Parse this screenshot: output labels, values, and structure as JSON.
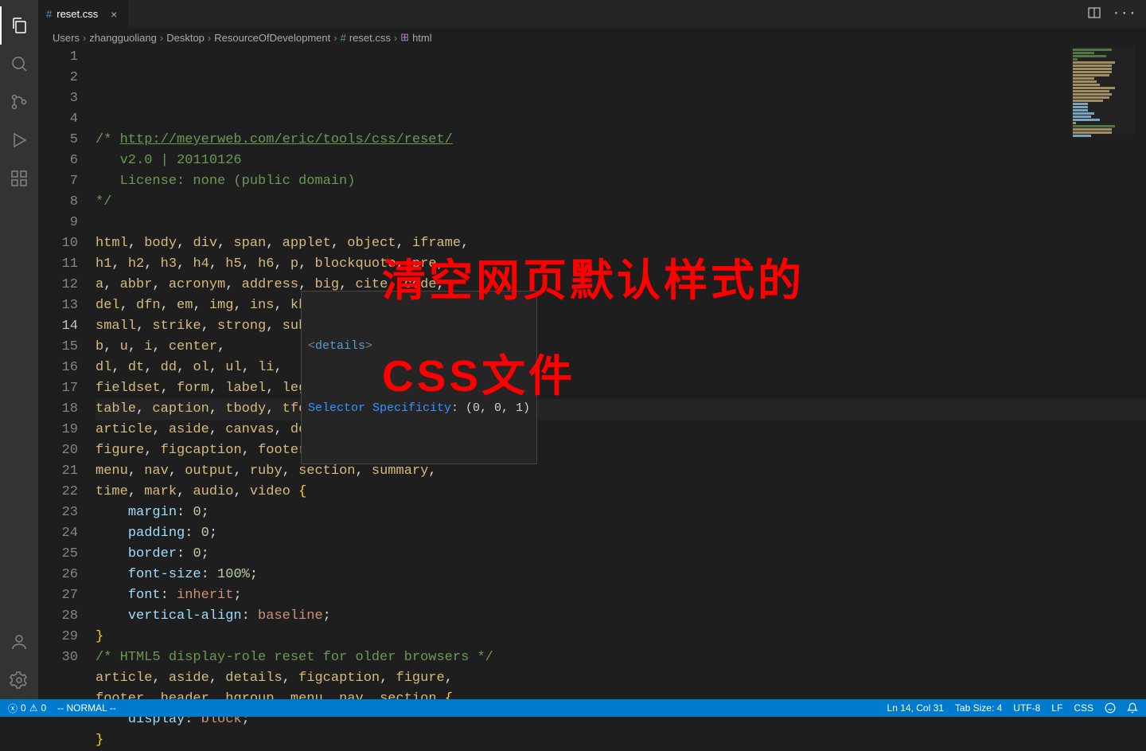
{
  "tabs": {
    "active": {
      "name": "reset.css",
      "icon": "#"
    }
  },
  "breadcrumb": [
    "Users",
    "zhangguoliang",
    "Desktop",
    "ResourceOfDevelopment",
    "reset.css",
    "html"
  ],
  "hover": {
    "tag_open": "<",
    "tag_name": "details",
    "tag_close": ">",
    "label": "Selector Specificity",
    "value": ": (0, 0, 1)"
  },
  "overlay": {
    "line1": "清空网页默认样式的",
    "line2": "CSS文件"
  },
  "code": {
    "lines": [
      {
        "n": 1,
        "type": "comment_open",
        "a": "/* ",
        "b": "http://meyerweb.com/eric/tools/css/reset/"
      },
      {
        "n": 2,
        "type": "comment",
        "t": "   v2.0 | 20110126"
      },
      {
        "n": 3,
        "type": "comment",
        "t": "   License: none (public domain)"
      },
      {
        "n": 4,
        "type": "comment_close",
        "t": "*/"
      },
      {
        "n": 5,
        "type": "blank",
        "t": ""
      },
      {
        "n": 6,
        "type": "sel",
        "t": "html, body, div, span, applet, object, iframe,"
      },
      {
        "n": 7,
        "type": "sel",
        "t": "h1, h2, h3, h4, h5, h6, p, blockquote, pre,"
      },
      {
        "n": 8,
        "type": "sel",
        "t": "a, abbr, acronym, address, big, cite, code,"
      },
      {
        "n": 9,
        "type": "sel",
        "t": "del, dfn, em, img, ins, kbd, q, s, samp,"
      },
      {
        "n": 10,
        "type": "sel",
        "t": "small, strike, strong, sub, sup, tt, var,"
      },
      {
        "n": 11,
        "type": "sel",
        "t": "b, u, i, center,"
      },
      {
        "n": 12,
        "type": "sel",
        "t": "dl, dt, dd, ol, ul, li,"
      },
      {
        "n": 13,
        "type": "sel",
        "t": "fieldset, form, label, legend,"
      },
      {
        "n": 14,
        "type": "sel",
        "t": "table, caption, tbody, tfoot, thead, tr, th, td,",
        "active": true
      },
      {
        "n": 15,
        "type": "sel",
        "t": "article, aside, canvas, details, embed, "
      },
      {
        "n": 16,
        "type": "sel",
        "t": "figure, figcaption, footer, header, hgroup, "
      },
      {
        "n": 17,
        "type": "sel",
        "t": "menu, nav, output, ruby, section, summary,"
      },
      {
        "n": 18,
        "type": "sel_open",
        "t": "time, mark, audio, video ",
        "br": "{"
      },
      {
        "n": 19,
        "type": "decl",
        "p": "margin",
        "v": "0",
        "sep": ": ",
        "end": ";",
        "indent": "    "
      },
      {
        "n": 20,
        "type": "decl",
        "p": "padding",
        "v": "0",
        "sep": ": ",
        "end": ";",
        "indent": "    "
      },
      {
        "n": 21,
        "type": "decl",
        "p": "border",
        "v": "0",
        "sep": ": ",
        "end": ";",
        "indent": "    "
      },
      {
        "n": 22,
        "type": "decl",
        "p": "font-size",
        "v": "100%",
        "sep": ": ",
        "end": ";",
        "indent": "    "
      },
      {
        "n": 23,
        "type": "decl_kw",
        "p": "font",
        "v": "inherit",
        "sep": ": ",
        "end": ";",
        "indent": "    "
      },
      {
        "n": 24,
        "type": "decl_kw",
        "p": "vertical-align",
        "v": "baseline",
        "sep": ": ",
        "end": ";",
        "indent": "    "
      },
      {
        "n": 25,
        "type": "close",
        "t": "}"
      },
      {
        "n": 26,
        "type": "comment_line",
        "t": "/* HTML5 display-role reset for older browsers */"
      },
      {
        "n": 27,
        "type": "sel",
        "t": "article, aside, details, figcaption, figure,"
      },
      {
        "n": 28,
        "type": "sel_open",
        "t": "footer, header, hgroup, menu, nav, section ",
        "br": "{"
      },
      {
        "n": 29,
        "type": "decl_kw",
        "p": "display",
        "v": "block",
        "sep": ": ",
        "end": ";",
        "indent": "    "
      },
      {
        "n": 30,
        "type": "close",
        "t": "}"
      }
    ]
  },
  "status": {
    "errors": "0",
    "warnings": "0",
    "mode": "-- NORMAL --",
    "lncol": "Ln 14, Col 31",
    "indent": "Tab Size: 4",
    "encoding": "UTF-8",
    "eol": "LF",
    "lang": "CSS"
  }
}
